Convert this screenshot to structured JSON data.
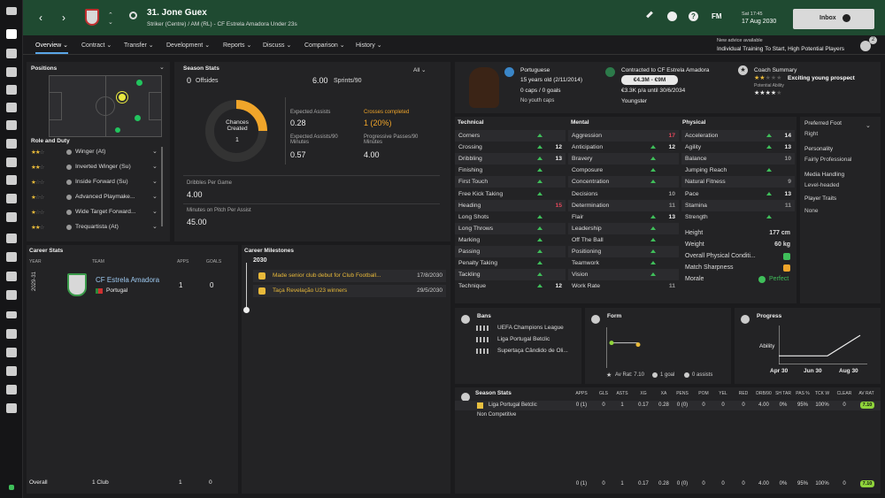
{
  "header": {
    "player_title": "31. Jone Guex",
    "player_sub": "Striker (Centre) / AM (RL) - CF Estrela Amadora Under 23s",
    "fm_label": "FM",
    "day_time": "Sat 17:45",
    "date": "17 Aug 2030",
    "inbox_label": "Inbox",
    "advice_title": "New advice available",
    "advice_text": "Individual Training To Start, High Potential Players",
    "advice_count": "2"
  },
  "tabs": [
    "Overview",
    "Contract",
    "Transfer",
    "Development",
    "Reports",
    "Discuss",
    "Comparison",
    "History"
  ],
  "positions": {
    "title": "Positions",
    "role_title": "Role and Duty",
    "roles": [
      {
        "name": "Winger (At)",
        "stars": 2
      },
      {
        "name": "Inverted Winger (Su)",
        "stars": 2
      },
      {
        "name": "Inside Forward (Su)",
        "stars": 1
      },
      {
        "name": "Advanced Playmake...",
        "stars": 1
      },
      {
        "name": "Wide Target Forward...",
        "stars": 1
      },
      {
        "name": "Trequartista (At)",
        "stars": 2
      }
    ]
  },
  "season_stats": {
    "title": "Season Stats",
    "filter": "All",
    "offsides_val": "0",
    "offsides_label": "Offsides",
    "sprints_val": "6.00",
    "sprints_label": "Sprints/90",
    "chances_label": "Chances Created",
    "chances_val": "1",
    "chances_fill": 0.25,
    "xa_label": "Expected Assists",
    "xa_val": "0.28",
    "crosses_label": "Crosses completed",
    "crosses_val": "1 (20%)",
    "xa90_label": "Expected Assists/90 Minutes",
    "xa90_val": "0.57",
    "pp90_label": "Progressive Passes/90 Minutes",
    "pp90_val": "4.00",
    "dribbles_label": "Dribbles Per Game",
    "dribbles_val": "4.00",
    "mins_label": "Minutes on Pitch Per Assist",
    "mins_val": "45.00"
  },
  "profile": {
    "nationality": "Portuguese",
    "age": "15 years old (2/11/2014)",
    "caps": "0 caps / 0 goals",
    "youth_caps": "No youth caps",
    "contract": "Contracted to CF Estrela Amadora",
    "value_range": "€4.3M - €9M",
    "wage": "€3.3K p/a until 30/6/2034",
    "status": "Youngster",
    "coach_title": "Coach Summary",
    "coach_text": "Exciting young prospect",
    "pa_label": "Potential Ability",
    "ca_stars": 2,
    "pa_stars": 4
  },
  "attributes": {
    "technical_title": "Technical",
    "mental_title": "Mental",
    "physical_title": "Physical",
    "technical": [
      {
        "n": "Corners",
        "v": ""
      },
      {
        "n": "Crossing",
        "v": "12"
      },
      {
        "n": "Dribbling",
        "v": "13"
      },
      {
        "n": "Finishing",
        "v": ""
      },
      {
        "n": "First Touch",
        "v": ""
      },
      {
        "n": "Free Kick Taking",
        "v": ""
      },
      {
        "n": "Heading",
        "v": "15"
      },
      {
        "n": "Long Shots",
        "v": ""
      },
      {
        "n": "Long Throws",
        "v": ""
      },
      {
        "n": "Marking",
        "v": ""
      },
      {
        "n": "Passing",
        "v": ""
      },
      {
        "n": "Penalty Taking",
        "v": ""
      },
      {
        "n": "Tackling",
        "v": ""
      },
      {
        "n": "Technique",
        "v": "12"
      }
    ],
    "mental": [
      {
        "n": "Aggression",
        "v": "17"
      },
      {
        "n": "Anticipation",
        "v": "12"
      },
      {
        "n": "Bravery",
        "v": ""
      },
      {
        "n": "Composure",
        "v": ""
      },
      {
        "n": "Concentration",
        "v": ""
      },
      {
        "n": "Decisions",
        "v": "10"
      },
      {
        "n": "Determination",
        "v": "11"
      },
      {
        "n": "Flair",
        "v": "13"
      },
      {
        "n": "Leadership",
        "v": ""
      },
      {
        "n": "Off The Ball",
        "v": ""
      },
      {
        "n": "Positioning",
        "v": ""
      },
      {
        "n": "Teamwork",
        "v": ""
      },
      {
        "n": "Vision",
        "v": ""
      },
      {
        "n": "Work Rate",
        "v": "11"
      }
    ],
    "physical": [
      {
        "n": "Acceleration",
        "v": "14"
      },
      {
        "n": "Agility",
        "v": "13"
      },
      {
        "n": "Balance",
        "v": "10"
      },
      {
        "n": "Jumping Reach",
        "v": ""
      },
      {
        "n": "Natural Fitness",
        "v": "9"
      },
      {
        "n": "Pace",
        "v": "13"
      },
      {
        "n": "Stamina",
        "v": "11"
      },
      {
        "n": "Strength",
        "v": ""
      }
    ],
    "height_label": "Height",
    "height": "177 cm",
    "weight_label": "Weight",
    "weight": "60 kg",
    "condition_label": "Overall Physical Conditi...",
    "sharpness_label": "Match Sharpness",
    "morale_label": "Morale",
    "morale": "Perfect"
  },
  "side_info": {
    "foot_title": "Preferred Foot",
    "foot": "Right",
    "personality_title": "Personality",
    "personality": "Fairly Professional",
    "media_title": "Media Handling",
    "media": "Level-headed",
    "traits_title": "Player Traits",
    "traits": "None"
  },
  "career": {
    "title": "Career Stats",
    "col_year": "YEAR",
    "col_team": "TEAM",
    "col_apps": "APPS",
    "col_goals": "GOALS",
    "year": "2029-31",
    "team": "CF Estrela Amadora",
    "country": "Portugal",
    "apps": "1",
    "goals": "0",
    "overall_label": "Overall",
    "overall_clubs": "1 Club",
    "overall_apps": "1",
    "overall_goals": "0"
  },
  "milestones": {
    "title": "Career Milestones",
    "year": "2030",
    "items": [
      {
        "text": "Made senior club debut for Club Football...",
        "date": "17/8/2030"
      },
      {
        "text": "Taça Revelação U23 winners",
        "date": "29/5/2030"
      }
    ]
  },
  "bans": {
    "title": "Bans",
    "items": [
      "UEFA Champions League",
      "Liga Portugal Betclic",
      "Supertaça Cândido de Oli..."
    ]
  },
  "form": {
    "title": "Form",
    "rating": "Av Rat: 7.10",
    "goals": "1 goal",
    "assists": "0 assists",
    "chart_data": {
      "type": "line",
      "values": [
        7.1,
        7.1
      ],
      "series_name": ""
    }
  },
  "progress": {
    "title": "Progress",
    "ylabel": "Ability",
    "xlabels": [
      "Apr 30",
      "Jun 30",
      "Aug 30"
    ],
    "chart_data": {
      "type": "line",
      "x": [
        "Apr 30",
        "Jun 30",
        "Aug 30"
      ],
      "values": [
        10,
        10,
        34
      ],
      "ylim": [
        0,
        100
      ]
    }
  },
  "season_table": {
    "title": "Season Stats",
    "cols": [
      "APPS",
      "GLS",
      "ASTS",
      "XG",
      "XA",
      "PENS",
      "POM",
      "YEL",
      "RED",
      "DRB/90",
      "SH TAR",
      "PAS %",
      "TCK W",
      "CLEAR",
      "AV RAT"
    ],
    "rows": [
      {
        "name": "Liga Portugal Betclic",
        "vals": [
          "0 (1)",
          "0",
          "1",
          "0.17",
          "0.28",
          "0 (0)",
          "0",
          "0",
          "0",
          "4.00",
          "0%",
          "95%",
          "100%",
          "0",
          "7.10"
        ]
      },
      {
        "name": "Non Competitive",
        "vals": [
          "",
          "",
          "",
          "",
          "",
          "",
          "",
          "",
          "",
          "",
          "",
          "",
          "",
          "",
          ""
        ]
      }
    ],
    "total": [
      "0 (1)",
      "0",
      "1",
      "0.17",
      "0.28",
      "0 (0)",
      "0",
      "0",
      "0",
      "4.00",
      "0%",
      "95%",
      "100%",
      "0",
      "7.10"
    ]
  },
  "colors": {
    "accent": "#1f4a31",
    "gold": "#e8b93a",
    "green": "#3fbf5a",
    "red": "#e0475a",
    "rating": "#8fd43b"
  }
}
